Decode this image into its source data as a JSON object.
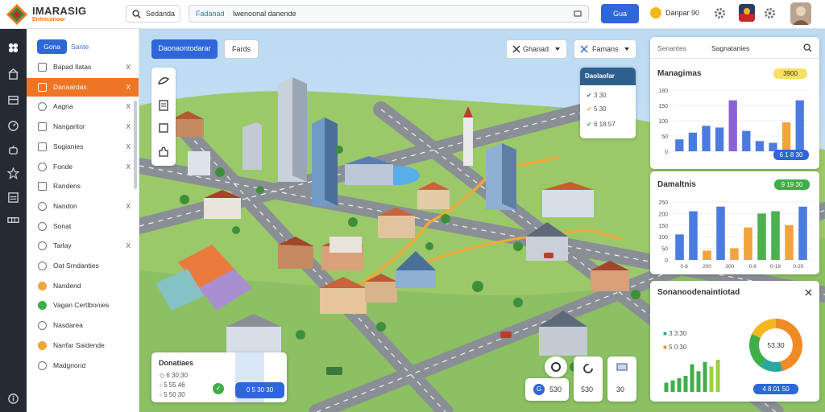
{
  "app": {
    "title": "IMARASIG",
    "subtitle": "Entrecanoar"
  },
  "topbar": {
    "search_label": "Sedanda",
    "address_highlight": "Fadanad",
    "address_text": "Iwenoonal danende",
    "go_label": "Gua",
    "user_label": "Danpar 90"
  },
  "sidebar": {
    "tabs": [
      "Gona",
      "Sante"
    ],
    "items": [
      {
        "label": "Bapad Ilatas",
        "icon": "doc-icon",
        "close": "X"
      },
      {
        "label": "Danaardas",
        "icon": "doc-icon",
        "close": "X",
        "active": true
      },
      {
        "label": "Aagna",
        "icon": "circle-icon",
        "close": "X"
      },
      {
        "label": "Nangaritor",
        "icon": "doc-icon",
        "close": "X"
      },
      {
        "label": "Sogianies",
        "icon": "doc-icon",
        "close": "X"
      },
      {
        "label": "Fonde",
        "icon": "circle-icon",
        "close": "X"
      },
      {
        "label": "Randens",
        "icon": "pencil-icon",
        "close": ""
      },
      {
        "label": "Nandon",
        "icon": "circle-icon",
        "close": "X"
      },
      {
        "label": "Sonat",
        "icon": "circle-icon",
        "close": ""
      },
      {
        "label": "Tarlay",
        "icon": "circle-icon",
        "close": "X"
      },
      {
        "label": "Oat Srndanties",
        "icon": "circle-icon",
        "close": ""
      },
      {
        "label": "Nandend",
        "icon": "dot-orange",
        "close": ""
      },
      {
        "label": "Vagan Certlbonies",
        "icon": "dot-green",
        "close": ""
      },
      {
        "label": "Nasdarea",
        "icon": "circle-icon",
        "close": ""
      },
      {
        "label": "Nanfar Saidende",
        "icon": "dot-orange",
        "close": ""
      },
      {
        "label": "Madgnond",
        "icon": "shield-icon",
        "close": ""
      }
    ]
  },
  "map_toolbar": {
    "primary_label": "Daonaontodarar",
    "secondary_label": "Fards",
    "dropdown1": "Ghanad",
    "dropdown2": "Famans"
  },
  "legend_card": {
    "title": "Daolaofar",
    "rows": [
      "3 30",
      "5 30",
      "6 18:57"
    ]
  },
  "stats_panel": {
    "tab1": "Senantes",
    "tab2": "Sagnatanies",
    "chart1_title": "Managimas",
    "chart1_badge": "3900",
    "chart1_yticks": [
      "180",
      "150",
      "100",
      "50",
      "0"
    ],
    "chart1_pill": "6 1 8 30",
    "chart2_title": "Damaltnis",
    "chart2_badge": "9 19 30",
    "chart2_yticks": [
      "250",
      "200",
      "150",
      "100",
      "50",
      "0"
    ],
    "chart2_xticks": [
      "0-6",
      "200",
      "300",
      "0-8",
      "0-18",
      "0-20"
    ],
    "donut_title": "Sonanoodenaintiotad",
    "donut_rows": [
      "3 3:30",
      "5 0:30"
    ],
    "donut_center": "53.30",
    "donut_pill": "4 8.01 50"
  },
  "bottom_card": {
    "title": "Donatiaes",
    "rows": [
      "6 30:30",
      "5 55 46",
      "5 50 30"
    ],
    "button_label": "0 5 30 30"
  },
  "map_buttons": [
    {
      "label": "530"
    },
    {
      "label": "530"
    },
    {
      "label": "30"
    }
  ],
  "chart_data": [
    {
      "type": "bar",
      "title": "Managimas",
      "yticks": [
        "180",
        "150",
        "100",
        "50",
        "0"
      ],
      "ylim": [
        0,
        180
      ],
      "values": [
        35,
        55,
        75,
        70,
        150,
        60,
        30,
        25,
        85,
        150
      ],
      "colors": [
        "#4c7be0",
        "#4c7be0",
        "#4c7be0",
        "#4c7be0",
        "#8a63d2",
        "#4c7be0",
        "#4c7be0",
        "#4c7be0",
        "#f1a43b",
        "#4c7be0"
      ]
    },
    {
      "type": "bar",
      "title": "Damaltnis",
      "yticks": [
        "250",
        "200",
        "150",
        "100",
        "50",
        "0"
      ],
      "ylim": [
        0,
        250
      ],
      "xticks": [
        "0-6",
        "200",
        "300",
        "0-8",
        "0-18",
        "0-20"
      ],
      "values": [
        110,
        210,
        40,
        230,
        50,
        140,
        200,
        210,
        150,
        230
      ],
      "colors": [
        "#4c7be0",
        "#4c7be0",
        "#f1a43b",
        "#4c7be0",
        "#f1a43b",
        "#f1a43b",
        "#4cb050",
        "#4cb050",
        "#f1a43b",
        "#4c7be0"
      ]
    },
    {
      "type": "bar",
      "values": [
        8,
        10,
        12,
        14,
        24,
        18,
        26,
        22,
        28
      ],
      "colors": [
        "#3fae49",
        "#3fae49",
        "#3fae49",
        "#3fae49",
        "#3fae49",
        "#3fae49",
        "#3fae49",
        "#9ccf3c",
        "#9ccf3c"
      ]
    },
    {
      "type": "pie",
      "values": [
        46,
        14,
        22,
        18
      ],
      "colors": [
        "#f08a24",
        "#2aa8a0",
        "#3fae49",
        "#f3b61f"
      ]
    }
  ]
}
